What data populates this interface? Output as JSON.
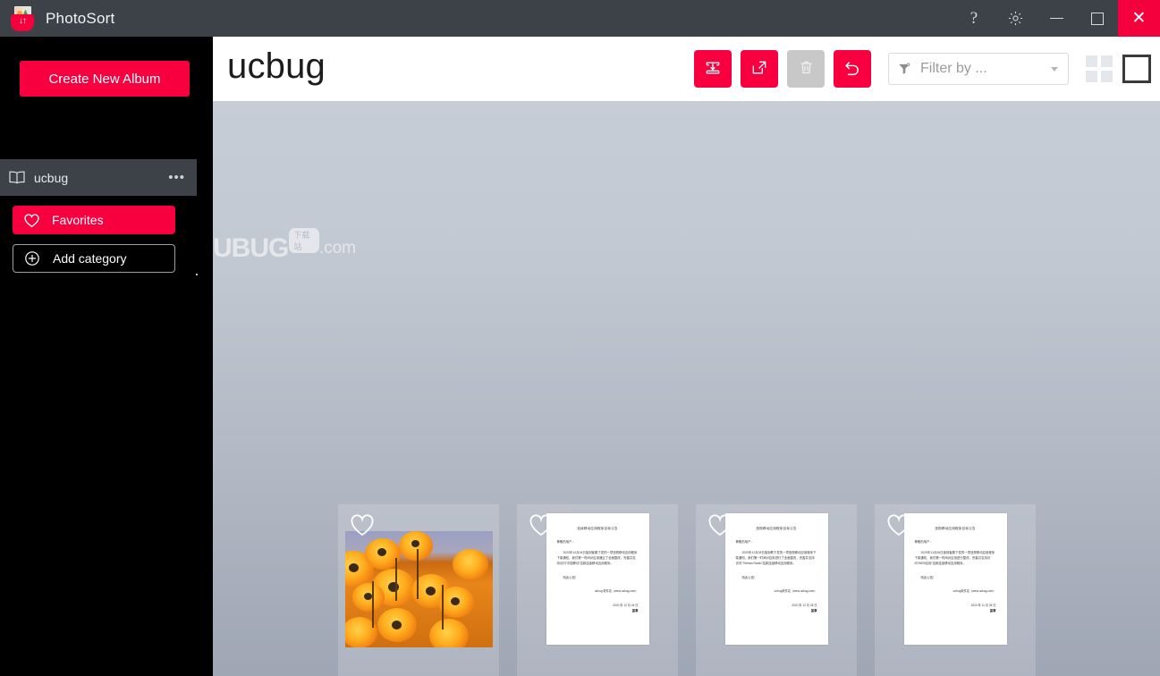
{
  "window": {
    "app_title": "PhotoSort",
    "logo_icon": "photo-basket-icon",
    "controls": {
      "help_label": "?",
      "help_icon": "help-icon",
      "settings_icon": "gear-icon",
      "minimize_icon": "minimize-icon",
      "maximize_icon": "maximize-icon",
      "close_icon": "close-icon",
      "close_label": "✕"
    },
    "accent_color": "#f8003f",
    "titlebar_color": "#3d4249"
  },
  "sidebar": {
    "create_album_label": "Create New Album",
    "album": {
      "name": "ucbug",
      "icon": "album-book-icon",
      "overflow_label": "•••",
      "overflow_icon": "more-options-icon"
    },
    "categories": [
      {
        "label": "Favorites",
        "icon": "heart-icon",
        "style": "filled"
      },
      {
        "label": "Add category",
        "icon": "plus-circle-icon",
        "style": "outlined"
      }
    ]
  },
  "main": {
    "page_title": "ucbug",
    "toolbar": [
      {
        "name": "import-button",
        "icon": "import-download-icon",
        "enabled": true
      },
      {
        "name": "export-button",
        "icon": "export-share-icon",
        "enabled": true
      },
      {
        "name": "delete-button",
        "icon": "trash-icon",
        "enabled": false
      },
      {
        "name": "undo-button",
        "icon": "undo-arrow-icon",
        "enabled": true
      }
    ],
    "filter": {
      "placeholder": "Filter by ...",
      "value": "Filter by ...",
      "icon": "funnel-filter-icon",
      "caret_icon": "chevron-down-icon"
    },
    "view_modes": [
      {
        "name": "grid-view-button",
        "icon": "grid-view-icon",
        "selected": false
      },
      {
        "name": "single-view-button",
        "icon": "single-view-icon",
        "selected": true
      }
    ],
    "watermark": {
      "text_u": "U",
      "text_main": "BUG",
      "badge": "下载站",
      "suffix": ".com"
    },
    "thumbnails": [
      {
        "type": "photo",
        "alt": "orange-daisy-flower-field",
        "favorite_icon": "heart-outline-icon",
        "favorited": false
      },
      {
        "type": "document",
        "favorite_icon": "heart-outline-icon",
        "favorited": false,
        "doc": {
          "title": "连续移动应用程序目标公告",
          "salutation": "尊敬的用户：",
          "body": "2020年12月04日接到客服下发的一项违规移动应用程序下架通知，我们第一时间对应用通过了全面整改，完善并支持访问“中国移动”这款连锁移动应用程序。",
          "thanks": "特此公告！",
          "sign_site": "ucbug 软件站（www.ucbug.com）",
          "sign_date": "2020 年 12 月 04 日",
          "stamp": "盖章"
        }
      },
      {
        "type": "document",
        "favorite_icon": "heart-outline-icon",
        "favorited": false,
        "doc": {
          "title": "违规移动应用程序目标公告",
          "salutation": "尊敬的用户：",
          "body": "2020年12月28日接到教下发的一项违规移动应用程序下架通知，我们第一时间对应用进行了全面整改，完善并支持访问“Tibetan Radio”这款连锁移动应用程序。",
          "thanks": "特此公告！",
          "sign_site": "ucbug软件站（www.ucbug.com）",
          "sign_date": "2020 年 12 月 28 日",
          "stamp": "盖章"
        }
      },
      {
        "type": "document",
        "favorite_icon": "heart-outline-icon",
        "favorited": false,
        "doc": {
          "title": "违规移动应用程序目标公告",
          "salutation": "尊敬的用户：",
          "body": "2020年11月26日接到客服下发的一项违规移动应用程序下架通知，我们第一时间对应用进行整改，完善并支持访问“WEB应用”这款连锁移动应用程序。",
          "thanks": "特此公告！",
          "sign_site": "ucbug软件站（www.ucbug.com）",
          "sign_date": "2020 年 11 月 26 日",
          "stamp": "盖章"
        }
      }
    ]
  }
}
